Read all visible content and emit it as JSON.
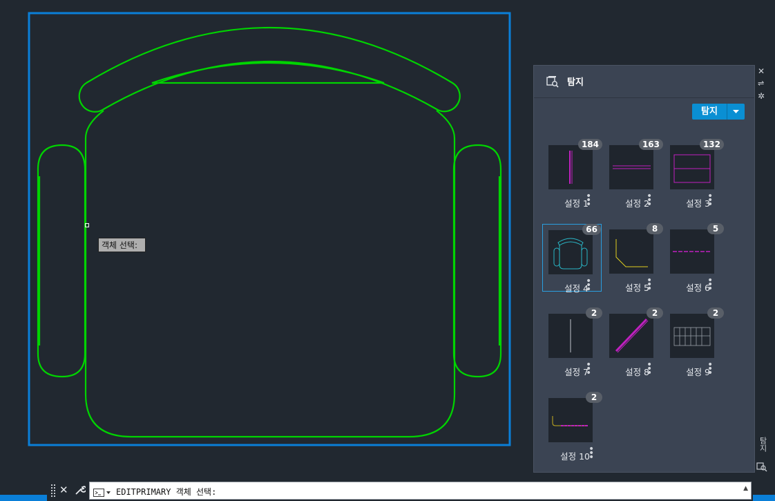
{
  "cursor_tooltip": "객체 선택:",
  "palette": {
    "title": "탐지",
    "explore_button": "탐지",
    "side_title": "탐지",
    "items": [
      {
        "name": "설정 1",
        "count": "184"
      },
      {
        "name": "설정 2",
        "count": "163"
      },
      {
        "name": "설정 3",
        "count": "132"
      },
      {
        "name": "설정 4",
        "count": "66"
      },
      {
        "name": "설정 5",
        "count": "8"
      },
      {
        "name": "설정 6",
        "count": "5"
      },
      {
        "name": "설정 7",
        "count": "2"
      },
      {
        "name": "설정 8",
        "count": "2"
      },
      {
        "name": "설정 9",
        "count": "2"
      },
      {
        "name": "설정 10",
        "count": "2"
      }
    ],
    "selected_index": 3
  },
  "command_line": {
    "text": "EDITPRIMARY 객체 선택:"
  },
  "colors": {
    "background": "#212830",
    "selection": "#0a7fd8",
    "geometry": "#00d400",
    "accent": "#0a8fd3"
  }
}
